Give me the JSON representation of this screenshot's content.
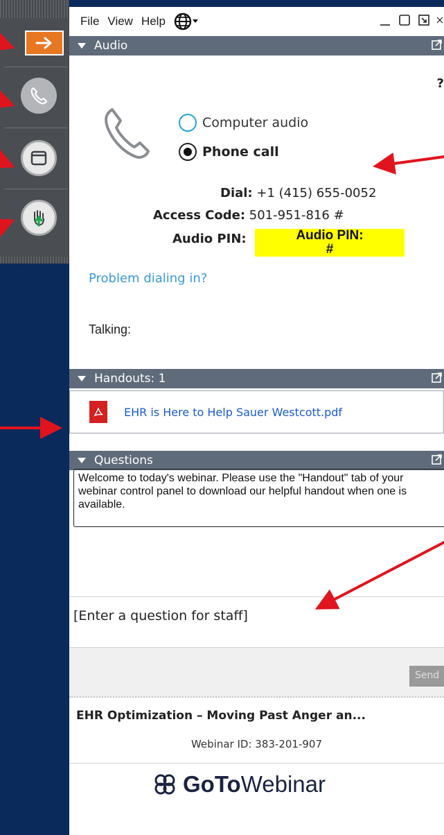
{
  "menubar": {
    "items": [
      "File",
      "View",
      "Help"
    ],
    "language_icon": "globe-icon"
  },
  "toolbar_icons": [
    "arrow-right-icon",
    "phone-icon",
    "window-icon",
    "raise-hand-icon"
  ],
  "audio": {
    "header": "Audio",
    "help": "?",
    "options": [
      {
        "label": "Computer audio",
        "selected": false
      },
      {
        "label": "Phone call",
        "selected": true
      }
    ],
    "dial_label": "Dial:",
    "dial_value": "+1 (415) 655-0052",
    "access_label": "Access Code:",
    "access_value": "501-951-816 #",
    "pin_label": "Audio PIN:",
    "pin_value_line1": "Audio PIN:",
    "pin_value_line2": "#",
    "problem_link": "Problem dialing in?",
    "talking_label": "Talking:"
  },
  "handouts": {
    "header": "Handouts: 1",
    "file_name": "EHR is Here to Help Sauer Westcott.pdf"
  },
  "questions": {
    "header": "Questions",
    "message": "Welcome to today's webinar.  Please use the \"Handout\" tab of your webinar control panel to download our helpful handout when one is available.",
    "input_placeholder": "[Enter a question for staff]",
    "send_label": "Send"
  },
  "footer": {
    "webinar_title": "EHR  Optimization – Moving Past Anger an...",
    "webinar_id": "Webinar ID: 383-201-907",
    "brand_bold": "GoTo",
    "brand_light": "Webinar"
  },
  "colors": {
    "header_bg": "#5f6a7a",
    "accent_orange": "#e87722",
    "highlight_yellow": "#ffff00",
    "link_blue": "#1a5bd1",
    "annotation_red": "#e0141e"
  }
}
